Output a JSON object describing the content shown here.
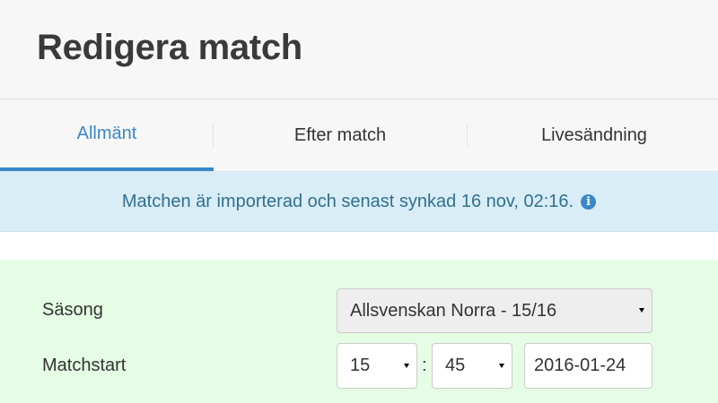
{
  "header": {
    "title": "Redigera match"
  },
  "tabs": [
    {
      "label": "Allmänt",
      "active": true
    },
    {
      "label": "Efter match",
      "active": false
    },
    {
      "label": "Livesändning",
      "active": false
    }
  ],
  "alert": {
    "text": "Matchen är importerad och senast synkad 16 nov, 02:16.",
    "icon": "info-icon"
  },
  "form": {
    "season": {
      "label": "Säsong",
      "selected": "Allsvenskan Norra - 15/16"
    },
    "match_start": {
      "label": "Matchstart",
      "hour": "15",
      "separator": ":",
      "minute": "45",
      "date": "2016-01-24"
    }
  },
  "colors": {
    "accent": "#3a87c8",
    "alert_bg": "#d9edf7",
    "alert_text": "#31708f",
    "form_bg": "#e4fde4",
    "header_bg": "#f7f7f7"
  }
}
